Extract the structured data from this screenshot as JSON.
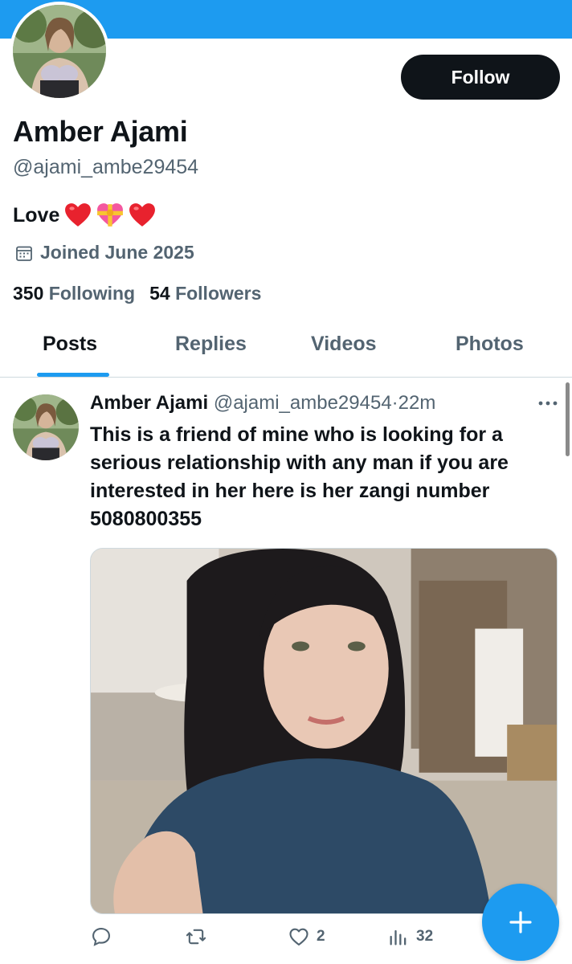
{
  "profile": {
    "name": "Amber Ajami",
    "handle": "@ajami_ambe29454",
    "bio_text": "Love",
    "bio_emoji": [
      "red-heart",
      "heart-with-ribbon",
      "red-heart"
    ],
    "joined": "Joined June 2025",
    "following_count": "350",
    "following_label": "Following",
    "followers_count": "54",
    "followers_label": "Followers",
    "follow_label": "Follow"
  },
  "tabs": [
    {
      "label": "Posts",
      "active": true
    },
    {
      "label": "Replies",
      "active": false
    },
    {
      "label": "Videos",
      "active": false
    },
    {
      "label": "Photos",
      "active": false
    }
  ],
  "post": {
    "author": "Amber Ajami",
    "handle": "@ajami_ambe29454",
    "separator": "·",
    "time": "22m",
    "text": "This is a friend of mine who is looking for a serious relationship with any man if you are interested in her here is her zangi number 5080800355",
    "likes": "2",
    "views": "32"
  },
  "colors": {
    "accent": "#1d9bf0",
    "text": "#0f1419",
    "muted": "#536471"
  },
  "icons": {
    "reply": "reply-icon",
    "repost": "repost-icon",
    "like": "heart-icon",
    "views": "views-icon",
    "compose": "plus-icon",
    "calendar": "calendar-icon",
    "more": "more-icon"
  }
}
